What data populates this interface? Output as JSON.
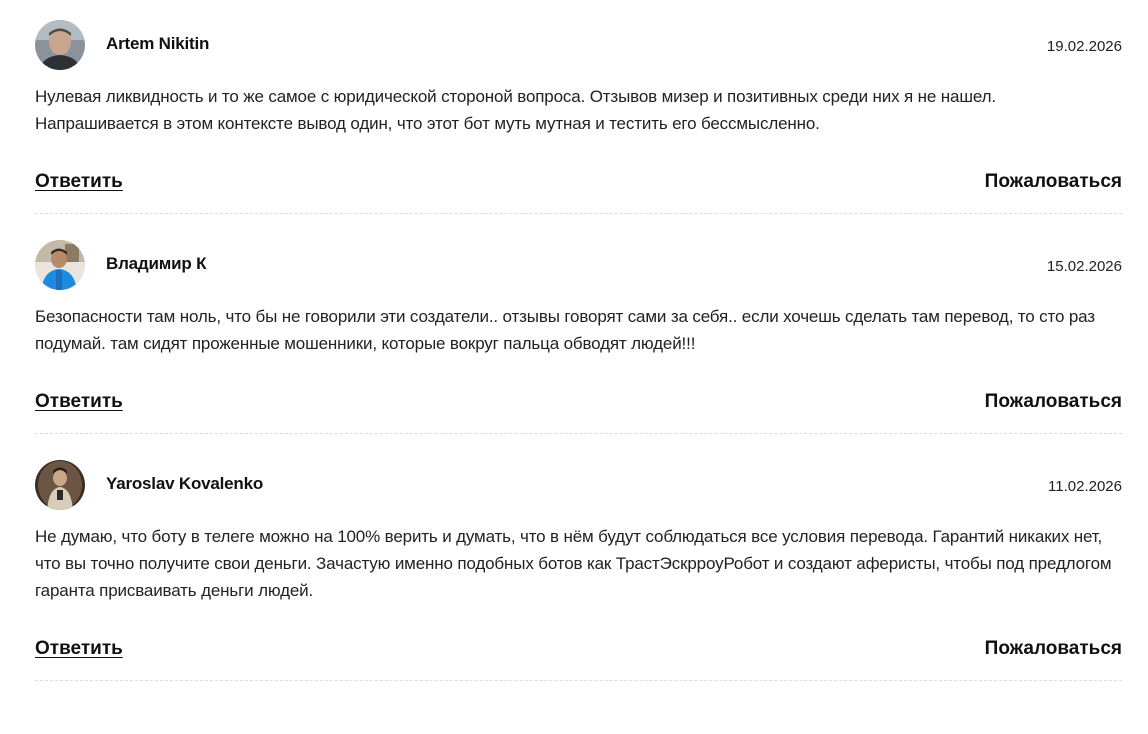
{
  "comments": [
    {
      "author": "Artem Nikitin",
      "date": "19.02.2026",
      "text": "Нулевая ликвидность и то же самое с юридической стороной вопроса. Отзывов мизер и позитивных среди них я не нашел. Напрашивается в этом контексте вывод один, что этот бот муть мутная и тестить его бессмысленно.",
      "reply_label": "Ответить",
      "report_label": "Пожаловаться"
    },
    {
      "author": "Владимир К",
      "date": "15.02.2026",
      "text": "Безопасности там ноль, что бы не говорили эти создатели.. отзывы говорят сами за себя.. если хочешь сделать там перевод, то сто раз подумай. там сидят проженные мошенники, которые вокруг пальца обводят людей!!!",
      "reply_label": "Ответить",
      "report_label": "Пожаловаться"
    },
    {
      "author": "Yaroslav Kovalenko",
      "date": "11.02.2026",
      "text": "Не думаю, что боту в телеге можно на 100% верить и думать, что в нём будут соблюдаться все условия перевода. Гарантий никаких нет, что вы точно получите свои деньги. Зачастую именно подобных ботов как ТрастЭскрроуРобот и создают аферисты, чтобы под предлогом гаранта присваивать деньги людей.",
      "reply_label": "Ответить",
      "report_label": "Пожаловаться"
    }
  ]
}
